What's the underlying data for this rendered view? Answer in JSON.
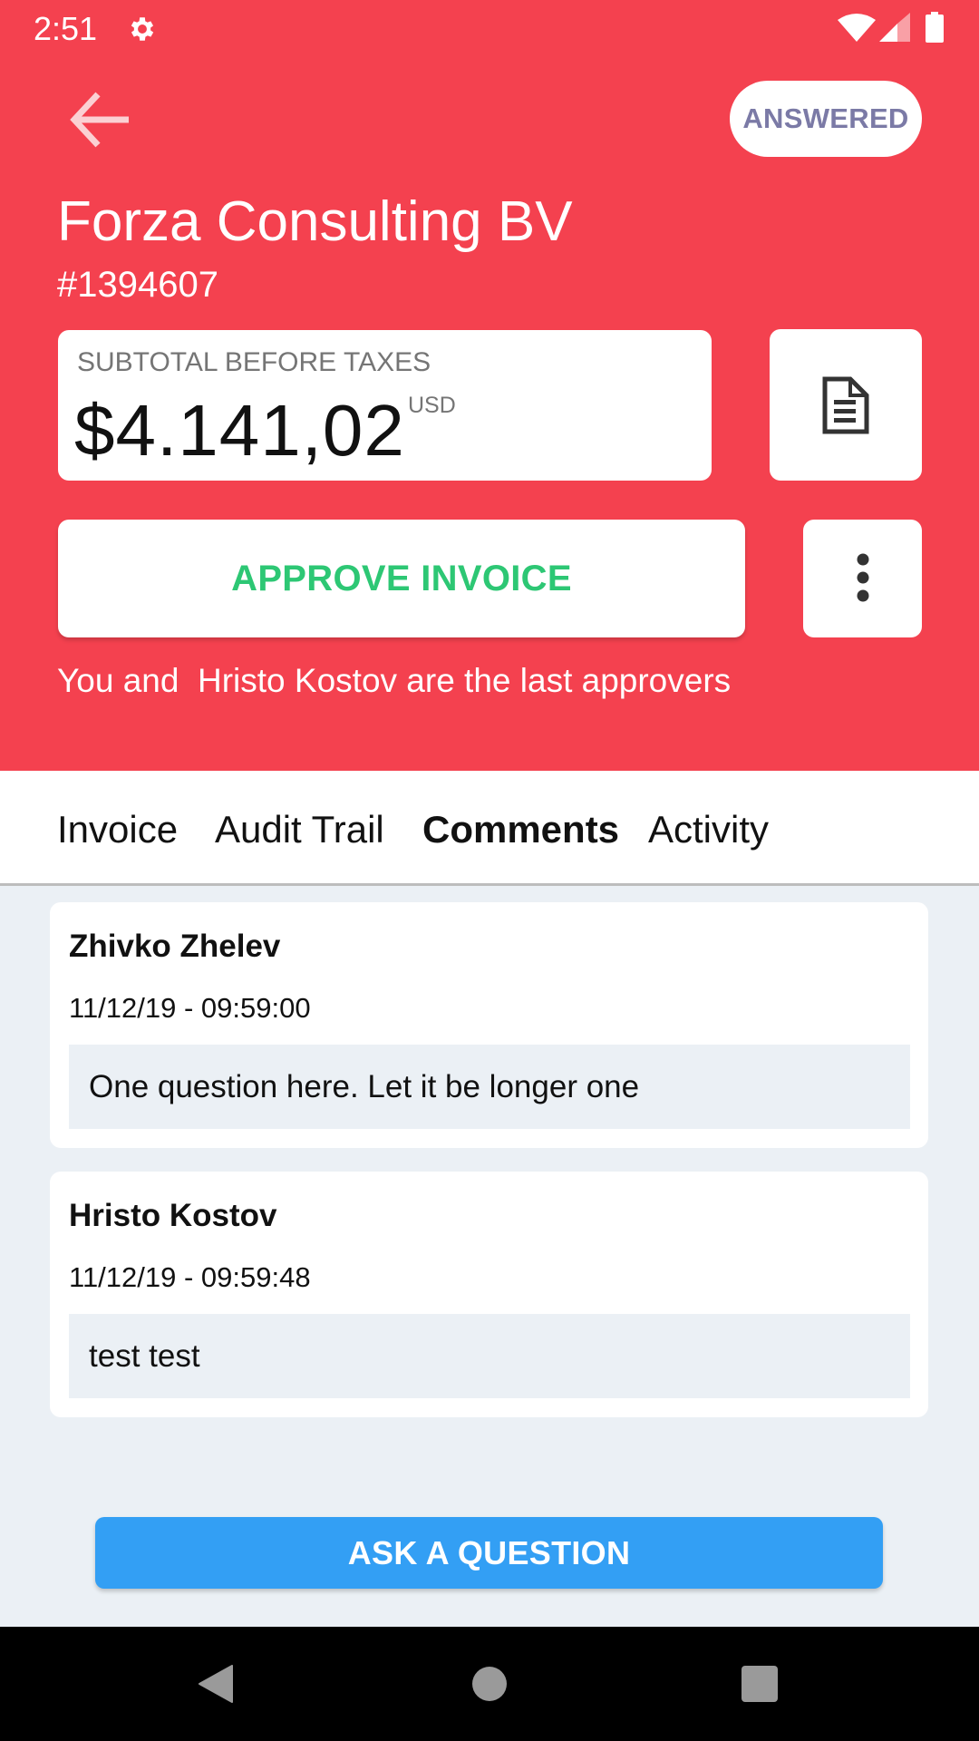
{
  "status_bar": {
    "time": "2:51",
    "icons": [
      "gear-icon",
      "wifi-icon",
      "signal-icon",
      "battery-icon"
    ]
  },
  "header": {
    "back_icon": "arrow-left-icon",
    "status_badge": "ANSWERED",
    "title": "Forza Consulting BV",
    "invoice_number": "#1394607",
    "subtotal": {
      "label": "SUBTOTAL BEFORE TAXES",
      "amount": "$4.141,02",
      "currency": "USD"
    },
    "document_icon": "document-icon",
    "approve_label": "APPROVE INVOICE",
    "more_icon": "more-vertical-icon",
    "approvers_note": "You and  Hristo Kostov are the last approvers"
  },
  "tabs": [
    {
      "label": "Invoice",
      "active": false
    },
    {
      "label": "Audit Trail",
      "active": false
    },
    {
      "label": "Comments",
      "active": true
    },
    {
      "label": "Activity",
      "active": false
    }
  ],
  "comments": [
    {
      "author": "Zhivko Zhelev",
      "date": "11/12/19 - 09:59:00",
      "text": "One question here. Let it be longer one"
    },
    {
      "author": "Hristo Kostov",
      "date": "11/12/19 - 09:59:48",
      "text": "test test"
    }
  ],
  "ask_button_label": "ASK A QUESTION",
  "nav_bar": [
    "back-icon",
    "home-icon",
    "recents-icon"
  ],
  "colors": {
    "header": "#f4414f",
    "approve_text": "#2dc774",
    "badge_text": "#7b7aa6",
    "ask_button": "#339ff4",
    "content_background": "#ebf0f5"
  }
}
